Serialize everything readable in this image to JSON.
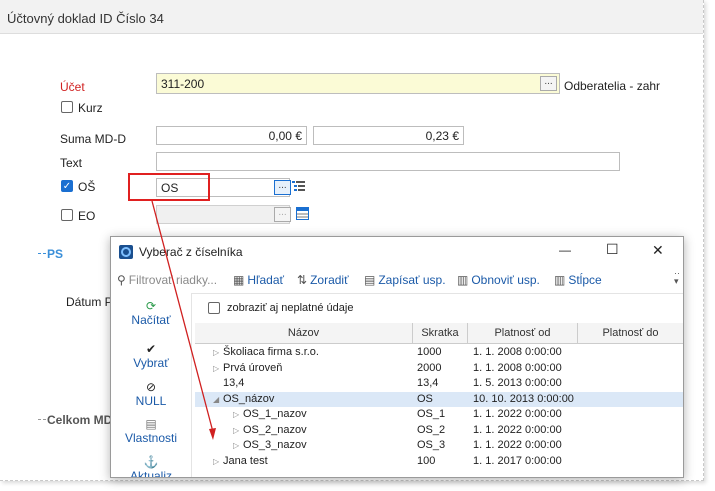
{
  "window_title": "Účtovný doklad ID Číslo 34",
  "form": {
    "ucet_label": "Účet",
    "ucet_value": "311-200",
    "ucet_btn": "...",
    "ucet_desc": "Odberatelia - zahr",
    "kurz_label": "Kurz",
    "suma_label": "Suma MD-D",
    "suma_md": "0,00 €",
    "suma_d": "0,23 €",
    "text_label": "Text",
    "text_value": "",
    "os_label": "OŠ",
    "os_value": "OS",
    "os_btn": "...",
    "eo_label": "EO",
    "eo_value": "",
    "eo_btn": "...",
    "ps_label": "PS",
    "datum_label": "Dátum P",
    "celkom_label": "Celkom MD/"
  },
  "dialog": {
    "title": "Vyberač z číselníka",
    "minimize": "—",
    "maximize": "☐",
    "close": "✕",
    "toolbar": {
      "filter": "Filtrovať riadky...",
      "find": "Hľadať",
      "sort": "Zoradiť",
      "save": "Zapísať usp.",
      "refresh": "Obnoviť usp.",
      "columns": "Stĺpce"
    },
    "side": {
      "load": "Načítať",
      "select": "Vybrať",
      "null": "NULL",
      "props": "Vlastnosti",
      "update": "Aktualiz"
    },
    "show_invalid_label": "zobraziť aj neplatné údaje",
    "columns": [
      "Názov",
      "Skratka",
      "Platnosť od",
      "Platnosť do"
    ],
    "rows": [
      {
        "name": "Školiaca firma  s.r.o.",
        "code": "1000",
        "from": "1. 1. 2008 0:00:00",
        "to": "",
        "level": 0,
        "tri": "▷"
      },
      {
        "name": "Prvá úroveň",
        "code": "2000",
        "from": "1. 1. 2008 0:00:00",
        "to": "",
        "level": 0,
        "tri": "▷"
      },
      {
        "name": "13,4",
        "code": "13,4",
        "from": "1. 5. 2013 0:00:00",
        "to": "",
        "level": 0,
        "tri": ""
      },
      {
        "name": "OS_názov",
        "code": "OS",
        "from": "10. 10. 2013 0:00:00",
        "to": "",
        "level": 0,
        "tri": "◢"
      },
      {
        "name": "OS_1_nazov",
        "code": "OS_1",
        "from": "1. 1. 2022 0:00:00",
        "to": "",
        "level": 1,
        "tri": "▷"
      },
      {
        "name": "OS_2_nazov",
        "code": "OS_2",
        "from": "1. 1. 2022 0:00:00",
        "to": "",
        "level": 1,
        "tri": "▷"
      },
      {
        "name": "OS_3_nazov",
        "code": "OS_3",
        "from": "1. 1. 2022 0:00:00",
        "to": "",
        "level": 1,
        "tri": "▷"
      },
      {
        "name": "Jana test",
        "code": "100",
        "from": "1. 1. 2017 0:00:00",
        "to": "",
        "level": 0,
        "tri": "▷"
      }
    ]
  },
  "colors": {
    "accent": "#1a6fd1",
    "highlight_box": "#e02020",
    "arrow": "#d02020",
    "selected_row": "#dbe8f7",
    "ucet_bg": "#fbfbd6"
  }
}
